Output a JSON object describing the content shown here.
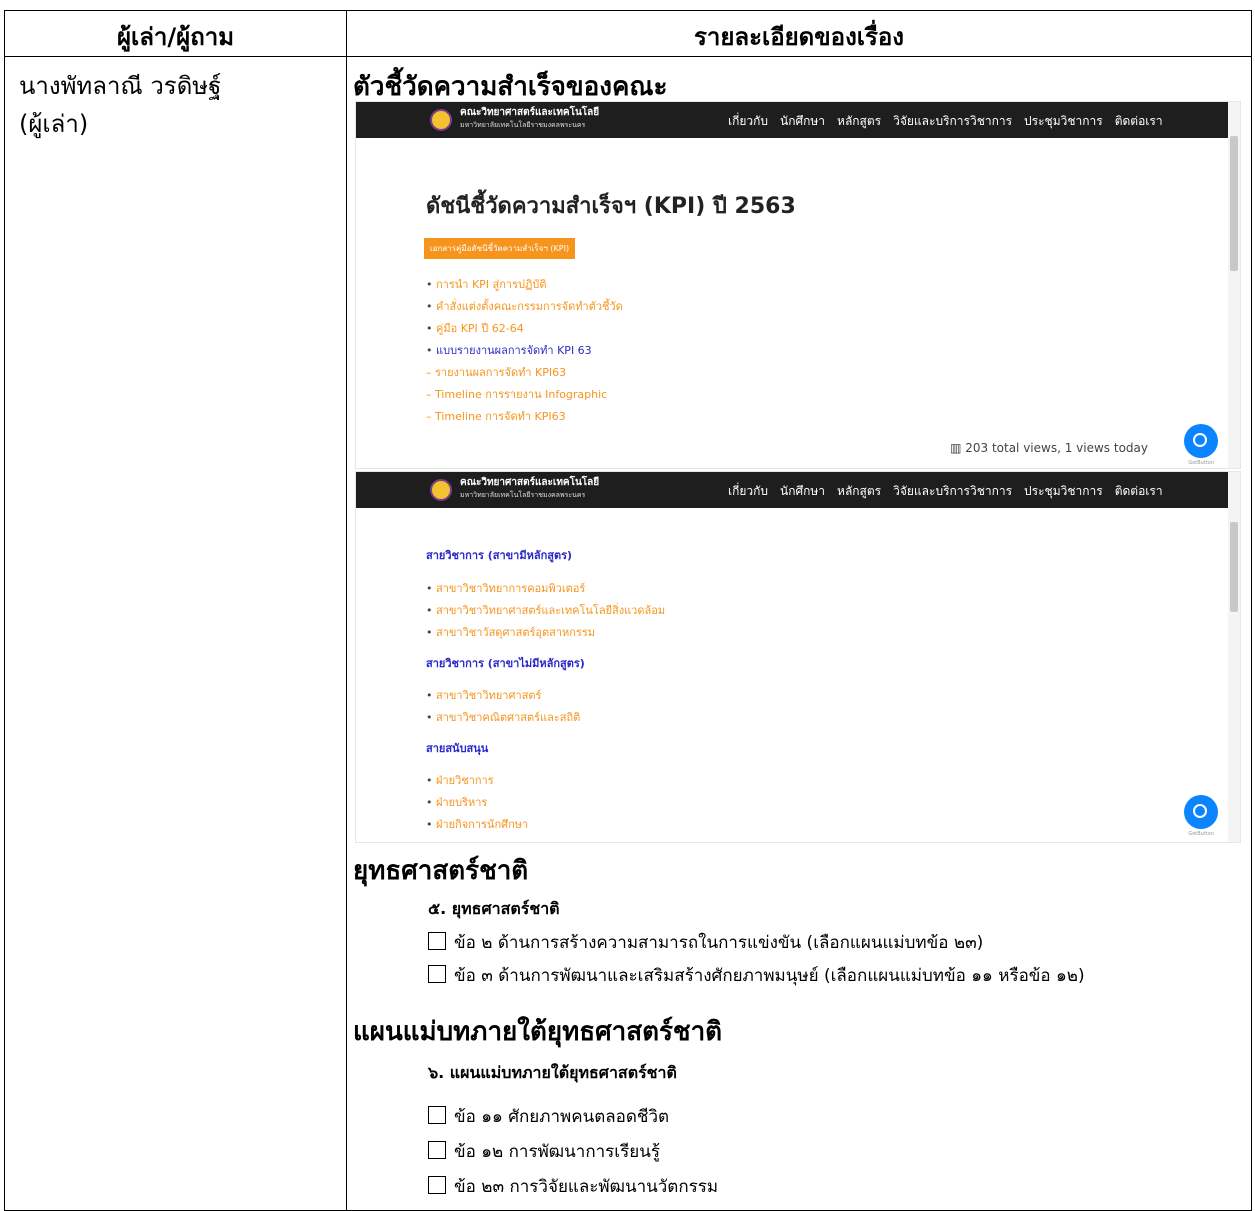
{
  "header": {
    "col1": "ผู้เล่า/ผู้ถาม",
    "col2": "รายละเอียดของเรื่อง"
  },
  "narrator": {
    "name": "นางพัทลาณี วรดิษฐ์",
    "role": "(ผู้เล่า)"
  },
  "section1": {
    "title": "ตัวชี้วัดความสำเร็จของคณะ"
  },
  "site": {
    "brand": "คณะวิทยาศาสตร์และเทคโนโลยี",
    "brand_sub": "มหาวิทยาลัยเทคโนโลยีราชมงคลพระนคร",
    "menu": [
      "เกี่ยวกับ",
      "นักศึกษา",
      "หลักสูตร",
      "วิจัยและบริการวิชาการ",
      "ประชุมวิชาการ",
      "ติดต่อเรา"
    ]
  },
  "shot1": {
    "title": "ดัชนีชี้วัดความสำเร็จฯ (KPI) ปี 2563",
    "button": "เอกสารคู่มือดัชนีชี้วัดความสำเร็จฯ (KPI)",
    "links": [
      "การนำ KPI สู่การปฏิบัติ",
      "คำสั่งแต่งตั้งคณะกรรมการจัดทำตัวชี้วัด",
      "คู่มือ KPI ปี 62-64",
      "แบบรายงานผลการจัดทำ KPI 63"
    ],
    "sublinks": [
      "– รายงานผลการจัดทำ KPI63",
      "– Timeline การรายงาน Infographic",
      "– Timeline การจัดทำ KPI63"
    ],
    "views": "203 total views, 1 views today",
    "getbutton": "GetButton"
  },
  "shot2": {
    "group1": "สายวิชาการ (สาขามีหลักสูตร)",
    "group1_items": [
      "สาขาวิชาวิทยาการคอมพิวเตอร์",
      "สาขาวิชาวิทยาศาสตร์และเทคโนโลยีสิ่งแวดล้อม",
      "สาขาวิชาวัสดุศาสตร์อุตสาหกรรม"
    ],
    "group2": "สายวิชาการ (สาขาไม่มีหลักสูตร)",
    "group2_items": [
      "สาขาวิชาวิทยาศาสตร์",
      "สาขาวิชาคณิตศาสตร์และสถิติ"
    ],
    "group3": "สายสนับสนุน",
    "group3_items": [
      "ฝ่ายวิชาการ",
      "ฝ่ายบริหาร",
      "ฝ่ายกิจการนักศึกษา"
    ],
    "getbutton": "GetButton"
  },
  "section2": {
    "title": "ยุทธศาสตร์ชาติ",
    "subtitle": "๕. ยุทธศาสตร์ชาติ",
    "items": [
      "ข้อ ๒  ด้านการสร้างความสามารถในการแข่งขัน (เลือกแผนแม่บทข้อ ๒๓)",
      "ข้อ ๓  ด้านการพัฒนาและเสริมสร้างศักยภาพมนุษย์ (เลือกแผนแม่บทข้อ ๑๑ หรือข้อ ๑๒)"
    ]
  },
  "section3": {
    "title": "แผนแม่บทภายใต้ยุทธศาสตร์ชาติ",
    "subtitle": "๖.  แผนแม่บทภายใต้ยุทธศาสตร์ชาติ",
    "items": [
      "ข้อ ๑๑ ศักยภาพคนตลอดชีวิต",
      "ข้อ ๑๒ การพัฒนาการเรียนรู้",
      "ข้อ ๒๓ การวิจัยและพัฒนานวัตกรรม"
    ]
  }
}
